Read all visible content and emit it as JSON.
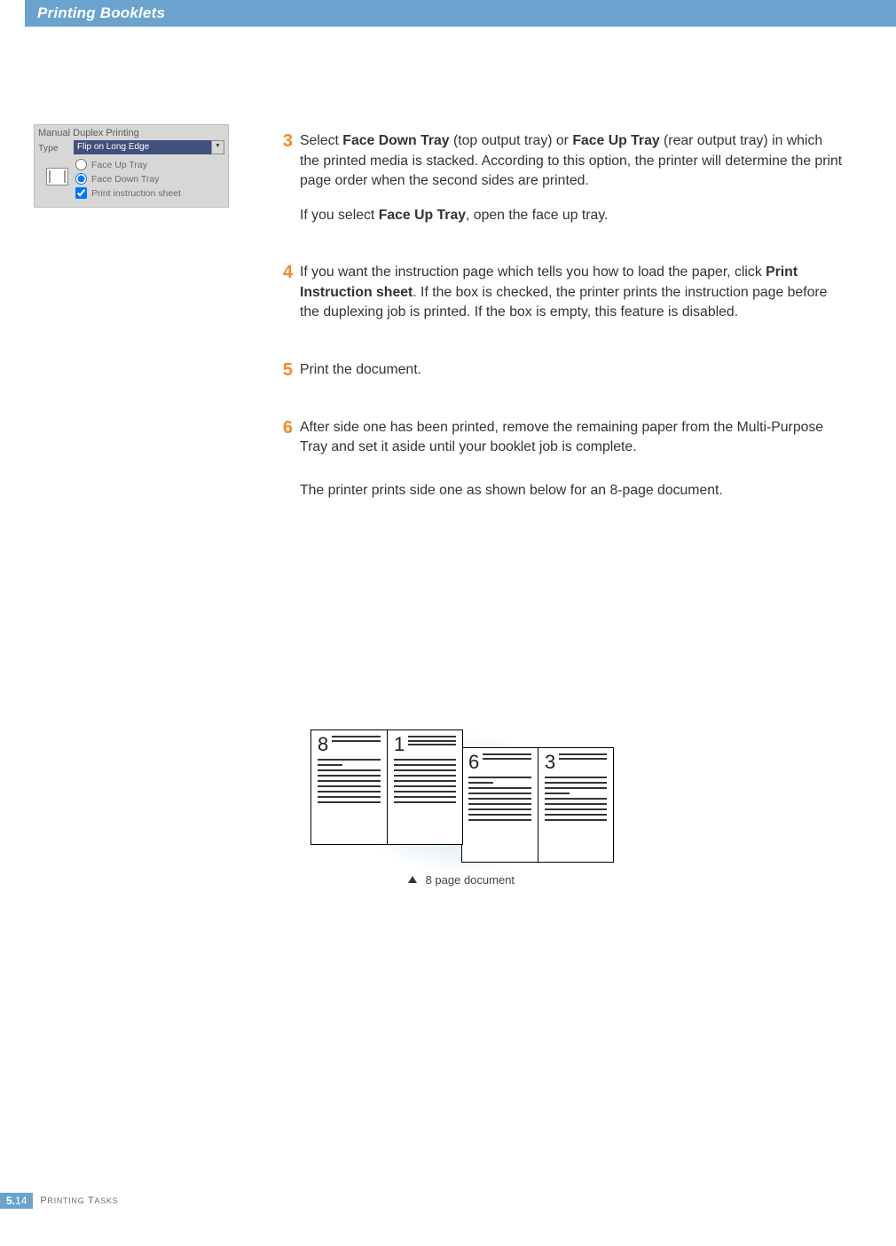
{
  "header": {
    "title": "Printing Booklets"
  },
  "panel": {
    "title": "Manual Duplex Printing",
    "type_label": "Type",
    "type_value": "Flip on Long Edge",
    "options": {
      "face_up": "Face Up Tray",
      "face_down": "Face Down Tray",
      "print_instruction": "Print instruction sheet"
    },
    "selected_radio": "face_down",
    "instruction_checked": true
  },
  "steps": [
    {
      "n": "3",
      "lines": [
        "Select <b>Face Down Tray</b> (top output tray) or <b>Face Up Tray</b> (rear output tray) in which the printed media is stacked. According to this option, the printer will determine the print page order when the second sides are printed.",
        "If you select <b>Face Up Tray</b>, open the face up tray."
      ]
    },
    {
      "n": "4",
      "lines": [
        "If you want the instruction page which tells you how to load the paper, click <b>Print Instruction sheet</b>. If the box is checked, the printer prints the instruction page before the duplexing job is printed. If the box is empty, this feature is disabled."
      ]
    },
    {
      "n": "5",
      "lines": [
        "Print the document."
      ]
    },
    {
      "n": "6",
      "lines": [
        "After side one has been printed, remove the remaining paper from the Multi-Purpose Tray and set it aside until your booklet job is complete.",
        "The printer prints side one as shown below for an 8-page document."
      ]
    }
  ],
  "diagram": {
    "pages": {
      "front_left": "8",
      "front_right": "1",
      "back_left": "6",
      "back_right": "3"
    },
    "caption": "8 page document"
  },
  "footer": {
    "chapter": "5.",
    "page": "14",
    "section_word1": "P",
    "section_rest1": "RINTING",
    "section_word2": "T",
    "section_rest2": "ASKS"
  }
}
